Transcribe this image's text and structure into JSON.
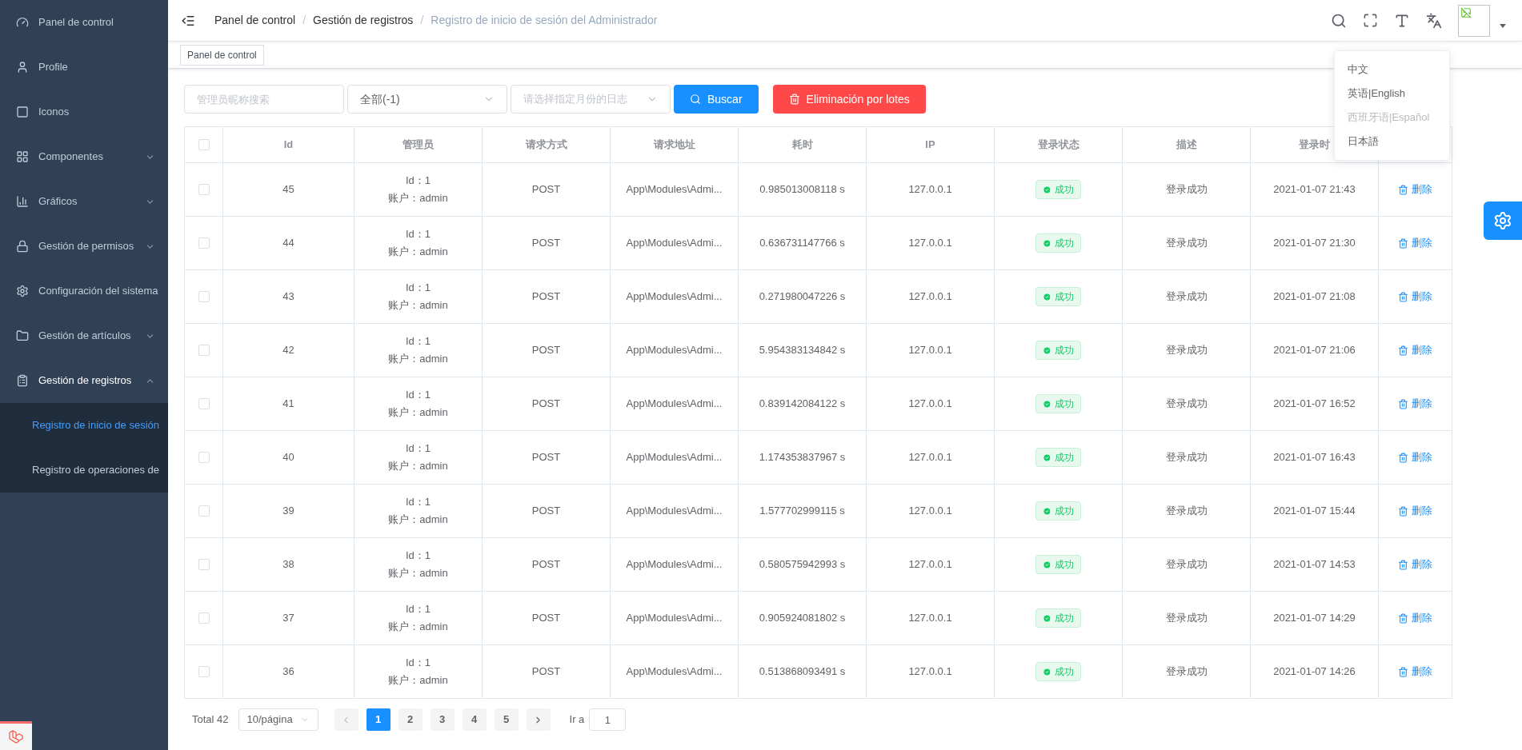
{
  "sidebar": {
    "items": [
      {
        "label": "Panel de control"
      },
      {
        "label": "Profile"
      },
      {
        "label": "Iconos"
      },
      {
        "label": "Componentes",
        "expanded": false
      },
      {
        "label": "Gráficos",
        "expanded": false
      },
      {
        "label": "Gestión de permisos",
        "expanded": false
      },
      {
        "label": "Configuración del sistema"
      },
      {
        "label": "Gestión de artículos",
        "expanded": false
      },
      {
        "label": "Gestión de registros",
        "expanded": true,
        "children": [
          {
            "label": "Registro de inicio de sesión",
            "selected": true
          },
          {
            "label": "Registro de operaciones de",
            "selected": false
          }
        ]
      }
    ]
  },
  "breadcrumb": {
    "separator": "/",
    "items": [
      "Panel de control",
      "Gestión de registros",
      "Registro de inicio de sesión del Administrador"
    ]
  },
  "tags": [
    "Panel de control"
  ],
  "language_menu": [
    {
      "label": "中文",
      "disabled": false
    },
    {
      "label": "英语|English",
      "disabled": false
    },
    {
      "label": "西班牙语|Español",
      "disabled": true
    },
    {
      "label": "日本語",
      "disabled": false
    }
  ],
  "filters": {
    "search": {
      "placeholder": "管理员昵称搜索"
    },
    "status": {
      "value": "全部(-1)"
    },
    "month": {
      "placeholder": "请选择指定月份的日志"
    },
    "search_button": "Buscar",
    "delete_button": "Eliminación por lotes"
  },
  "table": {
    "header_checked": false,
    "columns": [
      "Id",
      "管理员",
      "请求方式",
      "请求地址",
      "耗时",
      "IP",
      "登录状态",
      "描述",
      "登录时"
    ],
    "rows": [
      {
        "checked": false,
        "id": "45",
        "admin_id": "Id：1",
        "admin_account": "账户：admin",
        "method": "POST",
        "url": "App\\Modules\\Admi...",
        "time": "0.985013008118 s",
        "ip": "127.0.0.1",
        "status": "成功",
        "description": "登录成功",
        "login_time": "2021-01-07 21:43",
        "action": "删除"
      },
      {
        "checked": false,
        "id": "44",
        "admin_id": "Id：1",
        "admin_account": "账户：admin",
        "method": "POST",
        "url": "App\\Modules\\Admi...",
        "time": "0.636731147766 s",
        "ip": "127.0.0.1",
        "status": "成功",
        "description": "登录成功",
        "login_time": "2021-01-07 21:30",
        "action": "删除"
      },
      {
        "checked": false,
        "id": "43",
        "admin_id": "Id：1",
        "admin_account": "账户：admin",
        "method": "POST",
        "url": "App\\Modules\\Admi...",
        "time": "0.271980047226 s",
        "ip": "127.0.0.1",
        "status": "成功",
        "description": "登录成功",
        "login_time": "2021-01-07 21:08",
        "action": "删除"
      },
      {
        "checked": false,
        "id": "42",
        "admin_id": "Id：1",
        "admin_account": "账户：admin",
        "method": "POST",
        "url": "App\\Modules\\Admi...",
        "time": "5.954383134842 s",
        "ip": "127.0.0.1",
        "status": "成功",
        "description": "登录成功",
        "login_time": "2021-01-07 21:06",
        "action": "删除"
      },
      {
        "checked": false,
        "id": "41",
        "admin_id": "Id：1",
        "admin_account": "账户：admin",
        "method": "POST",
        "url": "App\\Modules\\Admi...",
        "time": "0.839142084122 s",
        "ip": "127.0.0.1",
        "status": "成功",
        "description": "登录成功",
        "login_time": "2021-01-07 16:52",
        "action": "删除"
      },
      {
        "checked": false,
        "id": "40",
        "admin_id": "Id：1",
        "admin_account": "账户：admin",
        "method": "POST",
        "url": "App\\Modules\\Admi...",
        "time": "1.174353837967 s",
        "ip": "127.0.0.1",
        "status": "成功",
        "description": "登录成功",
        "login_time": "2021-01-07 16:43",
        "action": "删除"
      },
      {
        "checked": false,
        "id": "39",
        "admin_id": "Id：1",
        "admin_account": "账户：admin",
        "method": "POST",
        "url": "App\\Modules\\Admi...",
        "time": "1.577702999115 s",
        "ip": "127.0.0.1",
        "status": "成功",
        "description": "登录成功",
        "login_time": "2021-01-07 15:44",
        "action": "删除"
      },
      {
        "checked": false,
        "id": "38",
        "admin_id": "Id：1",
        "admin_account": "账户：admin",
        "method": "POST",
        "url": "App\\Modules\\Admi...",
        "time": "0.580575942993 s",
        "ip": "127.0.0.1",
        "status": "成功",
        "description": "登录成功",
        "login_time": "2021-01-07 14:53",
        "action": "删除"
      },
      {
        "checked": false,
        "id": "37",
        "admin_id": "Id：1",
        "admin_account": "账户：admin",
        "method": "POST",
        "url": "App\\Modules\\Admi...",
        "time": "0.905924081802 s",
        "ip": "127.0.0.1",
        "status": "成功",
        "description": "登录成功",
        "login_time": "2021-01-07 14:29",
        "action": "删除"
      },
      {
        "checked": false,
        "id": "36",
        "admin_id": "Id：1",
        "admin_account": "账户：admin",
        "method": "POST",
        "url": "App\\Modules\\Admi...",
        "time": "0.513868093491 s",
        "ip": "127.0.0.1",
        "status": "成功",
        "description": "登录成功",
        "login_time": "2021-01-07 14:26",
        "action": "删除"
      }
    ]
  },
  "pagination": {
    "total": "Total 42",
    "page_size": "10/página",
    "pages": [
      {
        "label": "1",
        "selected": true
      },
      {
        "label": "2",
        "selected": false
      },
      {
        "label": "3",
        "selected": false
      },
      {
        "label": "4",
        "selected": false
      },
      {
        "label": "5",
        "selected": false
      }
    ],
    "goto_label": "Ir a",
    "goto_value": "1"
  }
}
